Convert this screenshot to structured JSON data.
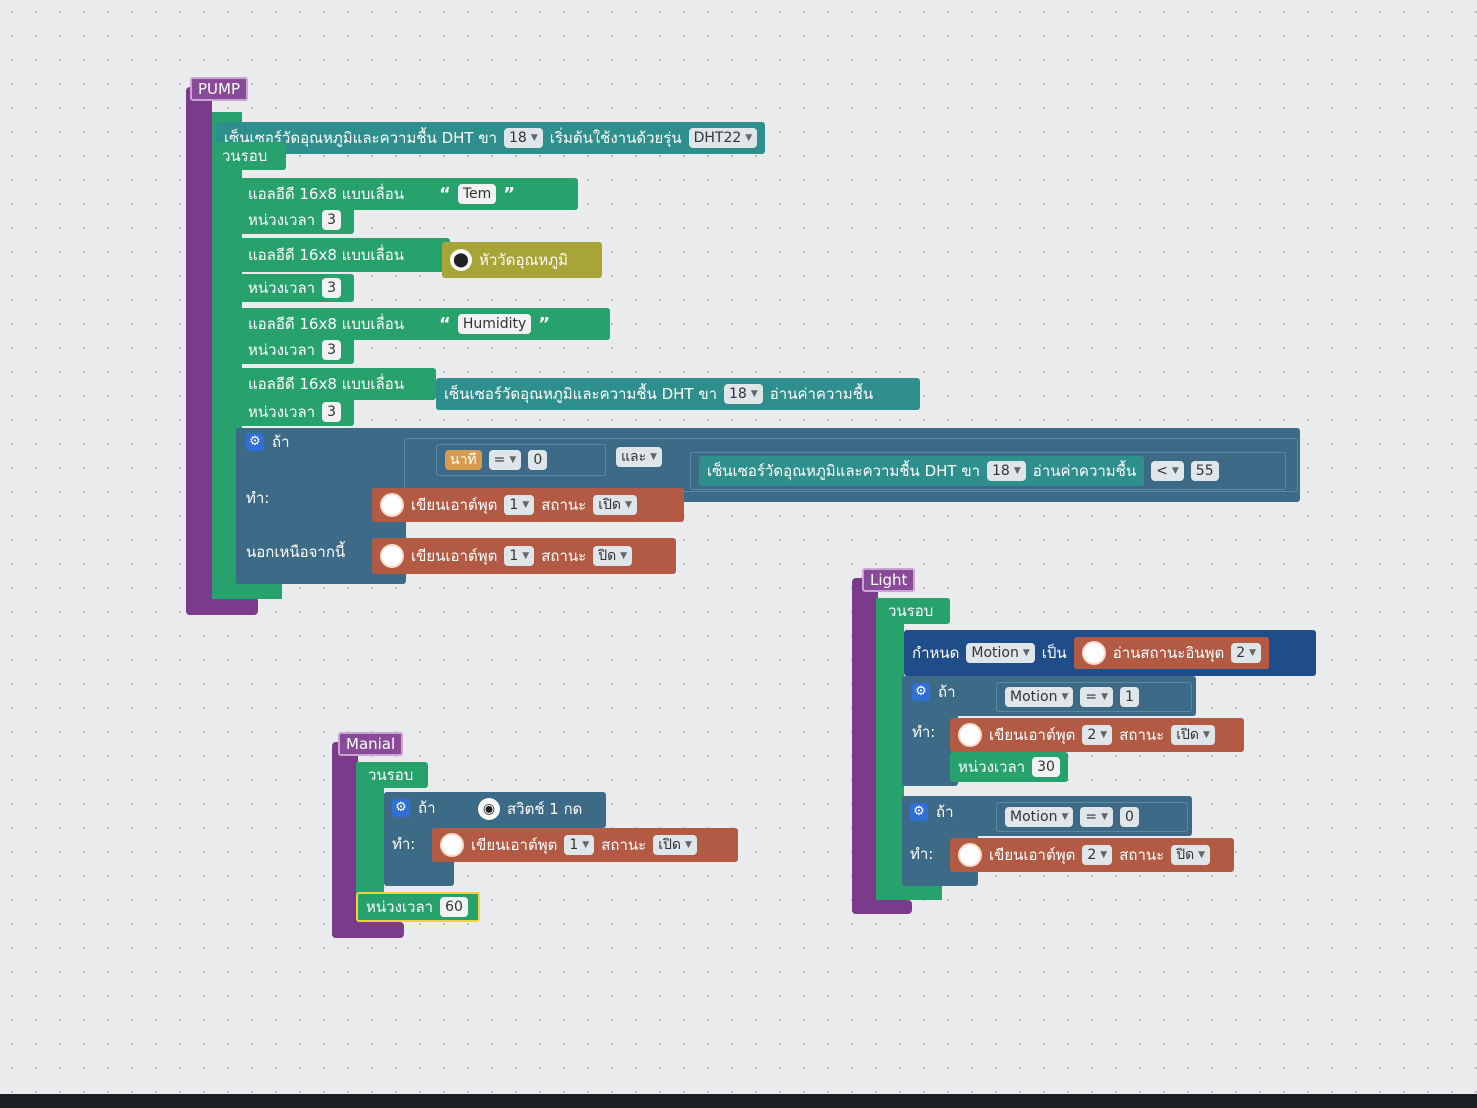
{
  "stacks": {
    "pump": {
      "name": "PUMP",
      "init_block": {
        "text": "เซ็นเซอร์วัดอุณหภูมิและความชื้น DHT ขา",
        "pin": "18",
        "suffix": "เริ่มต้นใช้งานด้วยรุ่น",
        "model": "DHT22"
      },
      "forever_label": "วนรอบ",
      "statements": [
        {
          "type": "led",
          "label": "แอลอีดี 16x8 แบบเลื่อน",
          "text_value": "Tem"
        },
        {
          "type": "delay",
          "label": "หน่วงเวลา",
          "value": "3"
        },
        {
          "type": "led",
          "label": "แอลอีดี 16x8 แบบเลื่อน",
          "sensor_text": "หัววัดอุณหภูมิ"
        },
        {
          "type": "delay",
          "label": "หน่วงเวลา",
          "value": "3"
        },
        {
          "type": "led",
          "label": "แอลอีดี 16x8 แบบเลื่อน",
          "text_value": "Humidity"
        },
        {
          "type": "delay",
          "label": "หน่วงเวลา",
          "value": "3"
        },
        {
          "type": "led",
          "label": "แอลอีดี 16x8 แบบเลื่อน",
          "dht_text": "เซ็นเซอร์วัดอุณหภูมิและความชื้น DHT ขา",
          "pin": "18",
          "read": "อ่านค่าความชื้น"
        },
        {
          "type": "delay",
          "label": "หน่วงเวลา",
          "value": "3"
        }
      ],
      "if_block": {
        "if_label": "ถ้า",
        "do_label": "ทำ:",
        "else_label": "นอกเหนือจากนี้",
        "cond": {
          "minute_label": "นาที",
          "op1": "=",
          "val1": "0",
          "and_label": "และ",
          "dht_text": "เซ็นเซอร์วัดอุณหภูมิและความชื้น DHT ขา",
          "pin": "18",
          "read": "อ่านค่าความชื้น",
          "op2": "<",
          "val2": "55"
        },
        "do_write": {
          "label": "เขียนเอาต์พุต",
          "pin": "1",
          "state_label": "สถานะ",
          "state": "เปิด"
        },
        "else_write": {
          "label": "เขียนเอาต์พุต",
          "pin": "1",
          "state_label": "สถานะ",
          "state": "ปิด"
        }
      }
    },
    "light": {
      "name": "Light",
      "forever_label": "วนรอบ",
      "set_block": {
        "label": "กำหนด",
        "var": "Motion",
        "be": "เป็น",
        "read_label": "อ่านสถานะอินพุต",
        "pin": "2"
      },
      "if1": {
        "if_label": "ถ้า",
        "var": "Motion",
        "op": "=",
        "val": "1",
        "do_label": "ทำ:",
        "write": {
          "label": "เขียนเอาต์พุต",
          "pin": "2",
          "state_label": "สถานะ",
          "state": "เปิด"
        },
        "delay": {
          "label": "หน่วงเวลา",
          "value": "30"
        }
      },
      "if2": {
        "if_label": "ถ้า",
        "var": "Motion",
        "op": "=",
        "val": "0",
        "do_label": "ทำ:",
        "write": {
          "label": "เขียนเอาต์พุต",
          "pin": "2",
          "state_label": "สถานะ",
          "state": "ปิด"
        }
      }
    },
    "manual": {
      "name": "Manial",
      "forever_label": "วนรอบ",
      "if_block": {
        "if_label": "ถ้า",
        "switch_label": "สวิตช์ 1 กด",
        "do_label": "ทำ:",
        "write": {
          "label": "เขียนเอาต์พุต",
          "pin": "1",
          "state_label": "สถานะ",
          "state": "เปิด"
        }
      },
      "delay": {
        "label": "หน่วงเวลา",
        "value": "60"
      }
    }
  },
  "colors": {
    "function": "#7b3a8c",
    "loop": "#27a26c",
    "sensor": "#2f8f8c",
    "logic": "#3d6a86",
    "variable": "#1f4d8a",
    "output": "#b35a45",
    "time": "#d79a4e",
    "analog": "#a8a437"
  },
  "icons": [
    "gear-icon",
    "bulb-icon",
    "eye-icon",
    "dropdown-arrow-icon",
    "thermometer-icon"
  ]
}
